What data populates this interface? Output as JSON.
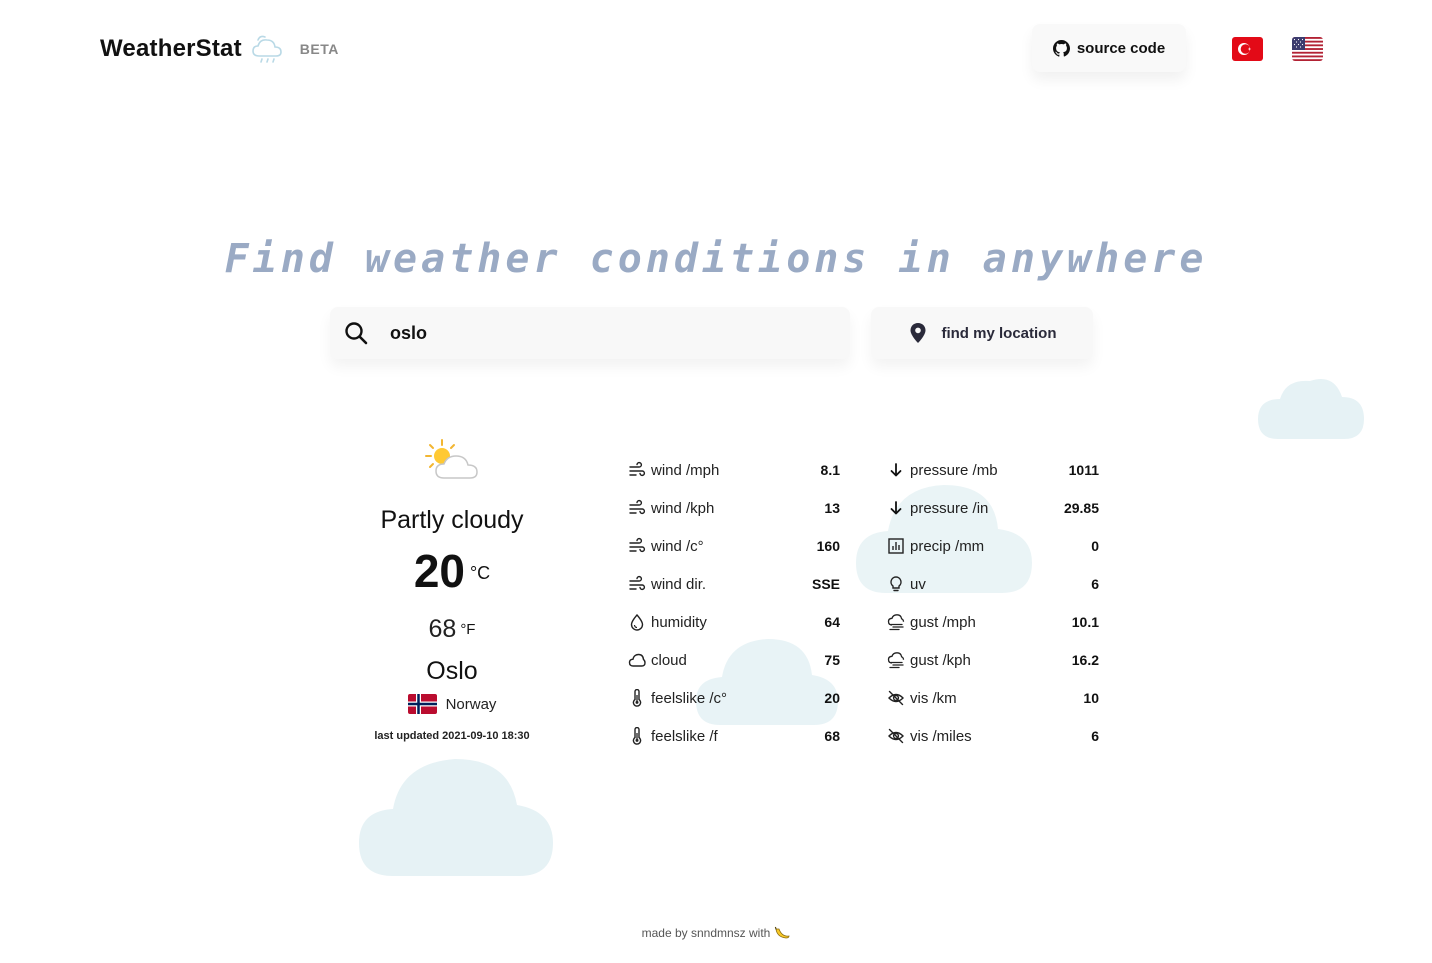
{
  "brand": {
    "name": "WeatherStat",
    "badge": "BETA",
    "icon": "cloud-rain-icon"
  },
  "header": {
    "source_label": "source code",
    "languages": [
      {
        "code": "tr",
        "icon": "turkey-flag-icon"
      },
      {
        "code": "en",
        "icon": "usa-flag-icon"
      }
    ]
  },
  "hero": {
    "title": "Find weather conditions in anywhere"
  },
  "search": {
    "value": "oslo",
    "placeholder": ""
  },
  "locate": {
    "label": "find my location"
  },
  "current": {
    "condition": "Partly cloudy",
    "temp_c": "20",
    "unit_c": "°C",
    "temp_f": "68",
    "unit_f": "°F",
    "city": "Oslo",
    "country": "Norway",
    "updated": "last updated 2021-09-10 18:30"
  },
  "stats_left": [
    {
      "icon": "wind-icon",
      "label": "wind /mph",
      "value": "8.1"
    },
    {
      "icon": "wind-icon",
      "label": "wind /kph",
      "value": "13"
    },
    {
      "icon": "wind-icon",
      "label": "wind /c°",
      "value": "160"
    },
    {
      "icon": "wind-icon",
      "label": "wind dir.",
      "value": "SSE"
    },
    {
      "icon": "droplet-icon",
      "label": "humidity",
      "value": "64"
    },
    {
      "icon": "cloud-icon",
      "label": "cloud",
      "value": "75"
    },
    {
      "icon": "thermometer-icon",
      "label": "feelslike /c°",
      "value": "20"
    },
    {
      "icon": "thermometer-icon",
      "label": "feelslike /f",
      "value": "68"
    }
  ],
  "stats_right": [
    {
      "icon": "arrow-down-icon",
      "label": "pressure /mb",
      "value": "1011"
    },
    {
      "icon": "arrow-down-icon",
      "label": "pressure /in",
      "value": "29.85"
    },
    {
      "icon": "bar-chart-icon",
      "label": "precip /mm",
      "value": "0"
    },
    {
      "icon": "bulb-icon",
      "label": "uv",
      "value": "6"
    },
    {
      "icon": "gust-icon",
      "label": "gust /mph",
      "value": "10.1"
    },
    {
      "icon": "gust-icon",
      "label": "gust /kph",
      "value": "16.2"
    },
    {
      "icon": "eye-off-icon",
      "label": "vis /km",
      "value": "10"
    },
    {
      "icon": "eye-off-icon",
      "label": "vis /miles",
      "value": "6"
    }
  ],
  "footer": {
    "text": "made by snndmnsz with"
  },
  "colors": {
    "title": "#9aaac4",
    "cloud": "#e6f2f5",
    "accent": "#111111"
  }
}
